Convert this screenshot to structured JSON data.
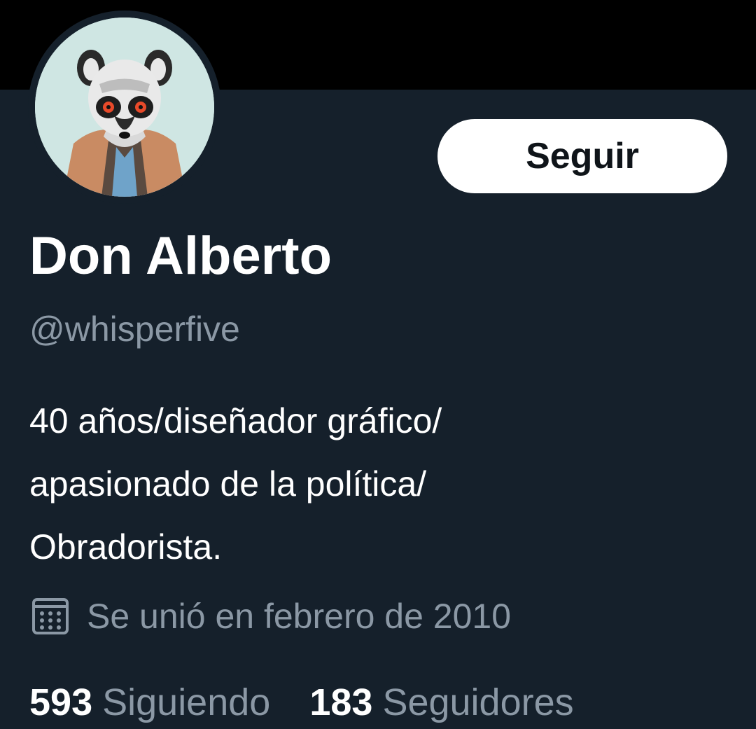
{
  "profile": {
    "display_name": "Don Alberto",
    "handle": "@whisperfive",
    "bio_lines": [
      "40 años/diseñador gráfico/",
      "apasionado de la política/",
      "Obradorista."
    ],
    "joined": "Se unió en febrero de 2010",
    "avatar_icon": "lemur-avatar"
  },
  "actions": {
    "follow_label": "Seguir"
  },
  "stats": {
    "following_count": "593",
    "following_label": "Siguiendo",
    "followers_count": "183",
    "followers_label": "Seguidores"
  },
  "colors": {
    "background": "#15202b",
    "banner": "#000000",
    "primary_text": "#ffffff",
    "secondary_text": "#8b98a5",
    "button_bg": "#ffffff",
    "button_text": "#0f1419"
  },
  "icons": {
    "joined_icon": "calendar-icon"
  }
}
